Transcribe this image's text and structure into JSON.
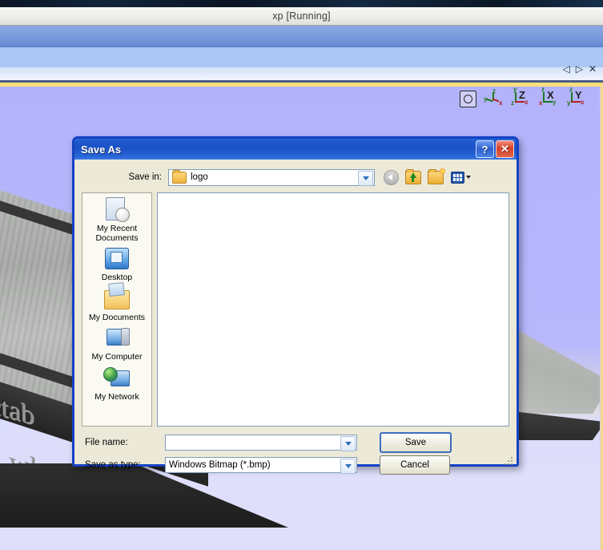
{
  "vm": {
    "title": "xp [Running]",
    "nav": {
      "prev": "◁",
      "next": "▷",
      "close": "✕"
    }
  },
  "viewport": {
    "background_color": "#b3b3fc",
    "scene_text_1": "ctab",
    "scene_text_2": "wha",
    "axis_toolbar": [
      {
        "name": "fit-extents",
        "label": ""
      },
      {
        "name": "iso-view",
        "label": "",
        "axes": [
          "y",
          "z",
          "x"
        ]
      },
      {
        "name": "z-view",
        "label": "Z",
        "axes": [
          "y",
          "z",
          "x"
        ]
      },
      {
        "name": "x-view",
        "label": "X",
        "axes": [
          "z",
          "x",
          "y"
        ]
      },
      {
        "name": "y-view",
        "label": "Y",
        "axes": [
          "z",
          "y",
          "x"
        ]
      }
    ]
  },
  "dialog": {
    "title": "Save As",
    "help_label": "?",
    "close_label": "✕",
    "save_in": {
      "label": "Save in:",
      "value": "logo"
    },
    "toolbar": [
      {
        "name": "back-button",
        "label": "Back"
      },
      {
        "name": "up-one-level-button",
        "label": "Up One Level"
      },
      {
        "name": "new-folder-button",
        "label": "Create New Folder"
      },
      {
        "name": "views-button",
        "label": "Views"
      }
    ],
    "places": [
      {
        "label": "My Recent\nDocuments",
        "line1": "My Recent",
        "line2": "Documents",
        "icon": "recent-documents-icon"
      },
      {
        "label": "Desktop",
        "line1": "Desktop",
        "line2": "",
        "icon": "desktop-icon"
      },
      {
        "label": "My Documents",
        "line1": "My Documents",
        "line2": "",
        "icon": "my-documents-icon"
      },
      {
        "label": "My Computer",
        "line1": "My Computer",
        "line2": "",
        "icon": "my-computer-icon"
      },
      {
        "label": "My Network",
        "line1": "My Network",
        "line2": "",
        "icon": "my-network-icon"
      }
    ],
    "file_list": {
      "items": [],
      "empty": true
    },
    "file_name": {
      "label": "File name:",
      "value": "",
      "placeholder": ""
    },
    "save_as_type": {
      "label": "Save as type:",
      "value": "Windows Bitmap (*.bmp)"
    },
    "buttons": {
      "save": "Save",
      "cancel": "Cancel"
    }
  }
}
